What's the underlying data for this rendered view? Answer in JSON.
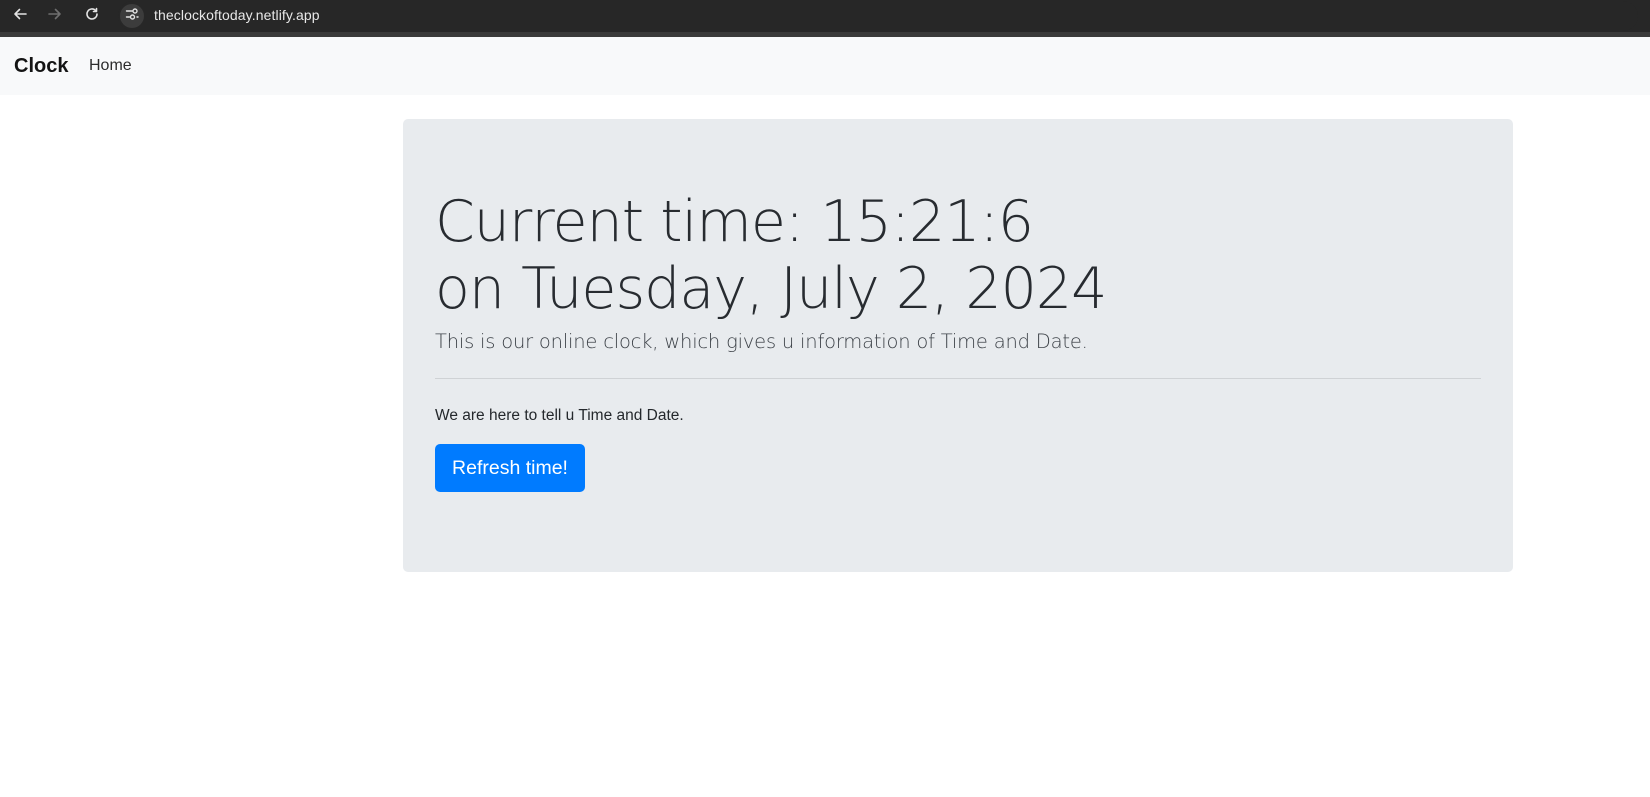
{
  "browser": {
    "back_icon": "arrow-left-icon",
    "forward_icon": "arrow-right-icon",
    "reload_icon": "reload-icon",
    "site_info_icon": "tune-icon",
    "url": "theclockoftoday.netlify.app"
  },
  "navbar": {
    "brand": "Clock",
    "links": [
      {
        "label": "Home"
      }
    ]
  },
  "jumbotron": {
    "time_line": "Current time: 15:21:6",
    "date_line": "on Tuesday, July 2, 2024",
    "lead": "This is our online clock, which gives u information of Time and Date.",
    "body": "We are here to tell u Time and Date.",
    "button_label": "Refresh time!"
  },
  "colors": {
    "accent": "#007bff",
    "jumbotron_bg": "#e8ebee",
    "navbar_bg": "#f8f9fa",
    "chrome_bg": "#272727"
  }
}
